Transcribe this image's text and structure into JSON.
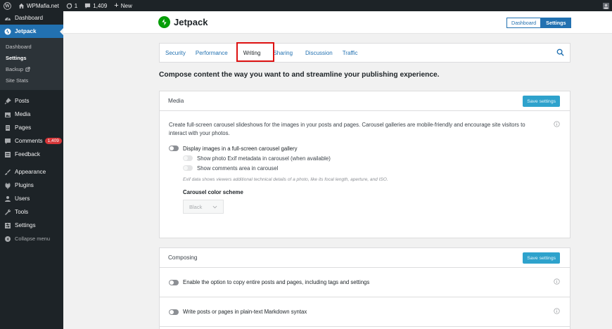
{
  "adminbar": {
    "site_name": "WPMafia.net",
    "updates_count": "1",
    "comments_count": "1,409",
    "new_label": "New"
  },
  "sidebar": {
    "dashboard": "Dashboard",
    "jetpack": "Jetpack",
    "submenu": [
      "Dashboard",
      "Settings",
      "Backup",
      "Site Stats"
    ],
    "posts": "Posts",
    "media": "Media",
    "pages": "Pages",
    "comments": "Comments",
    "comments_badge": "1,409",
    "feedback": "Feedback",
    "appearance": "Appearance",
    "plugins": "Plugins",
    "users": "Users",
    "tools": "Tools",
    "settings": "Settings",
    "collapse": "Collapse menu"
  },
  "header": {
    "brand": "Jetpack",
    "dashboard_btn": "Dashboard",
    "settings_btn": "Settings"
  },
  "tabs": [
    "Security",
    "Performance",
    "Writing",
    "Sharing",
    "Discussion",
    "Traffic"
  ],
  "intro": "Compose content the way you want to and streamline your publishing experience.",
  "media_card": {
    "title": "Media",
    "save": "Save settings",
    "description": "Create full-screen carousel slideshows for the images in your posts and pages. Carousel galleries are mobile-friendly and encourage site visitors to interact with your photos.",
    "toggle_main": "Display images in a full-screen carousel gallery",
    "toggle_exif": "Show photo Exif metadata in carousel (when available)",
    "toggle_comments": "Show comments area in carousel",
    "note": "Exif data shows viewers additional technical details of a photo, like its focal length, aperture, and ISO.",
    "scheme_label": "Carousel color scheme",
    "scheme_value": "Black"
  },
  "composing_card": {
    "title": "Composing",
    "save": "Save settings",
    "row1": "Enable the option to copy entire posts and pages, including tags and settings",
    "row2": "Write posts or pages in plain-text Markdown syntax"
  },
  "colors": {
    "admin_dark": "#1d2327",
    "wp_blue": "#2271b1",
    "jetpack_green": "#069e08",
    "highlight_red": "#dd1111"
  }
}
